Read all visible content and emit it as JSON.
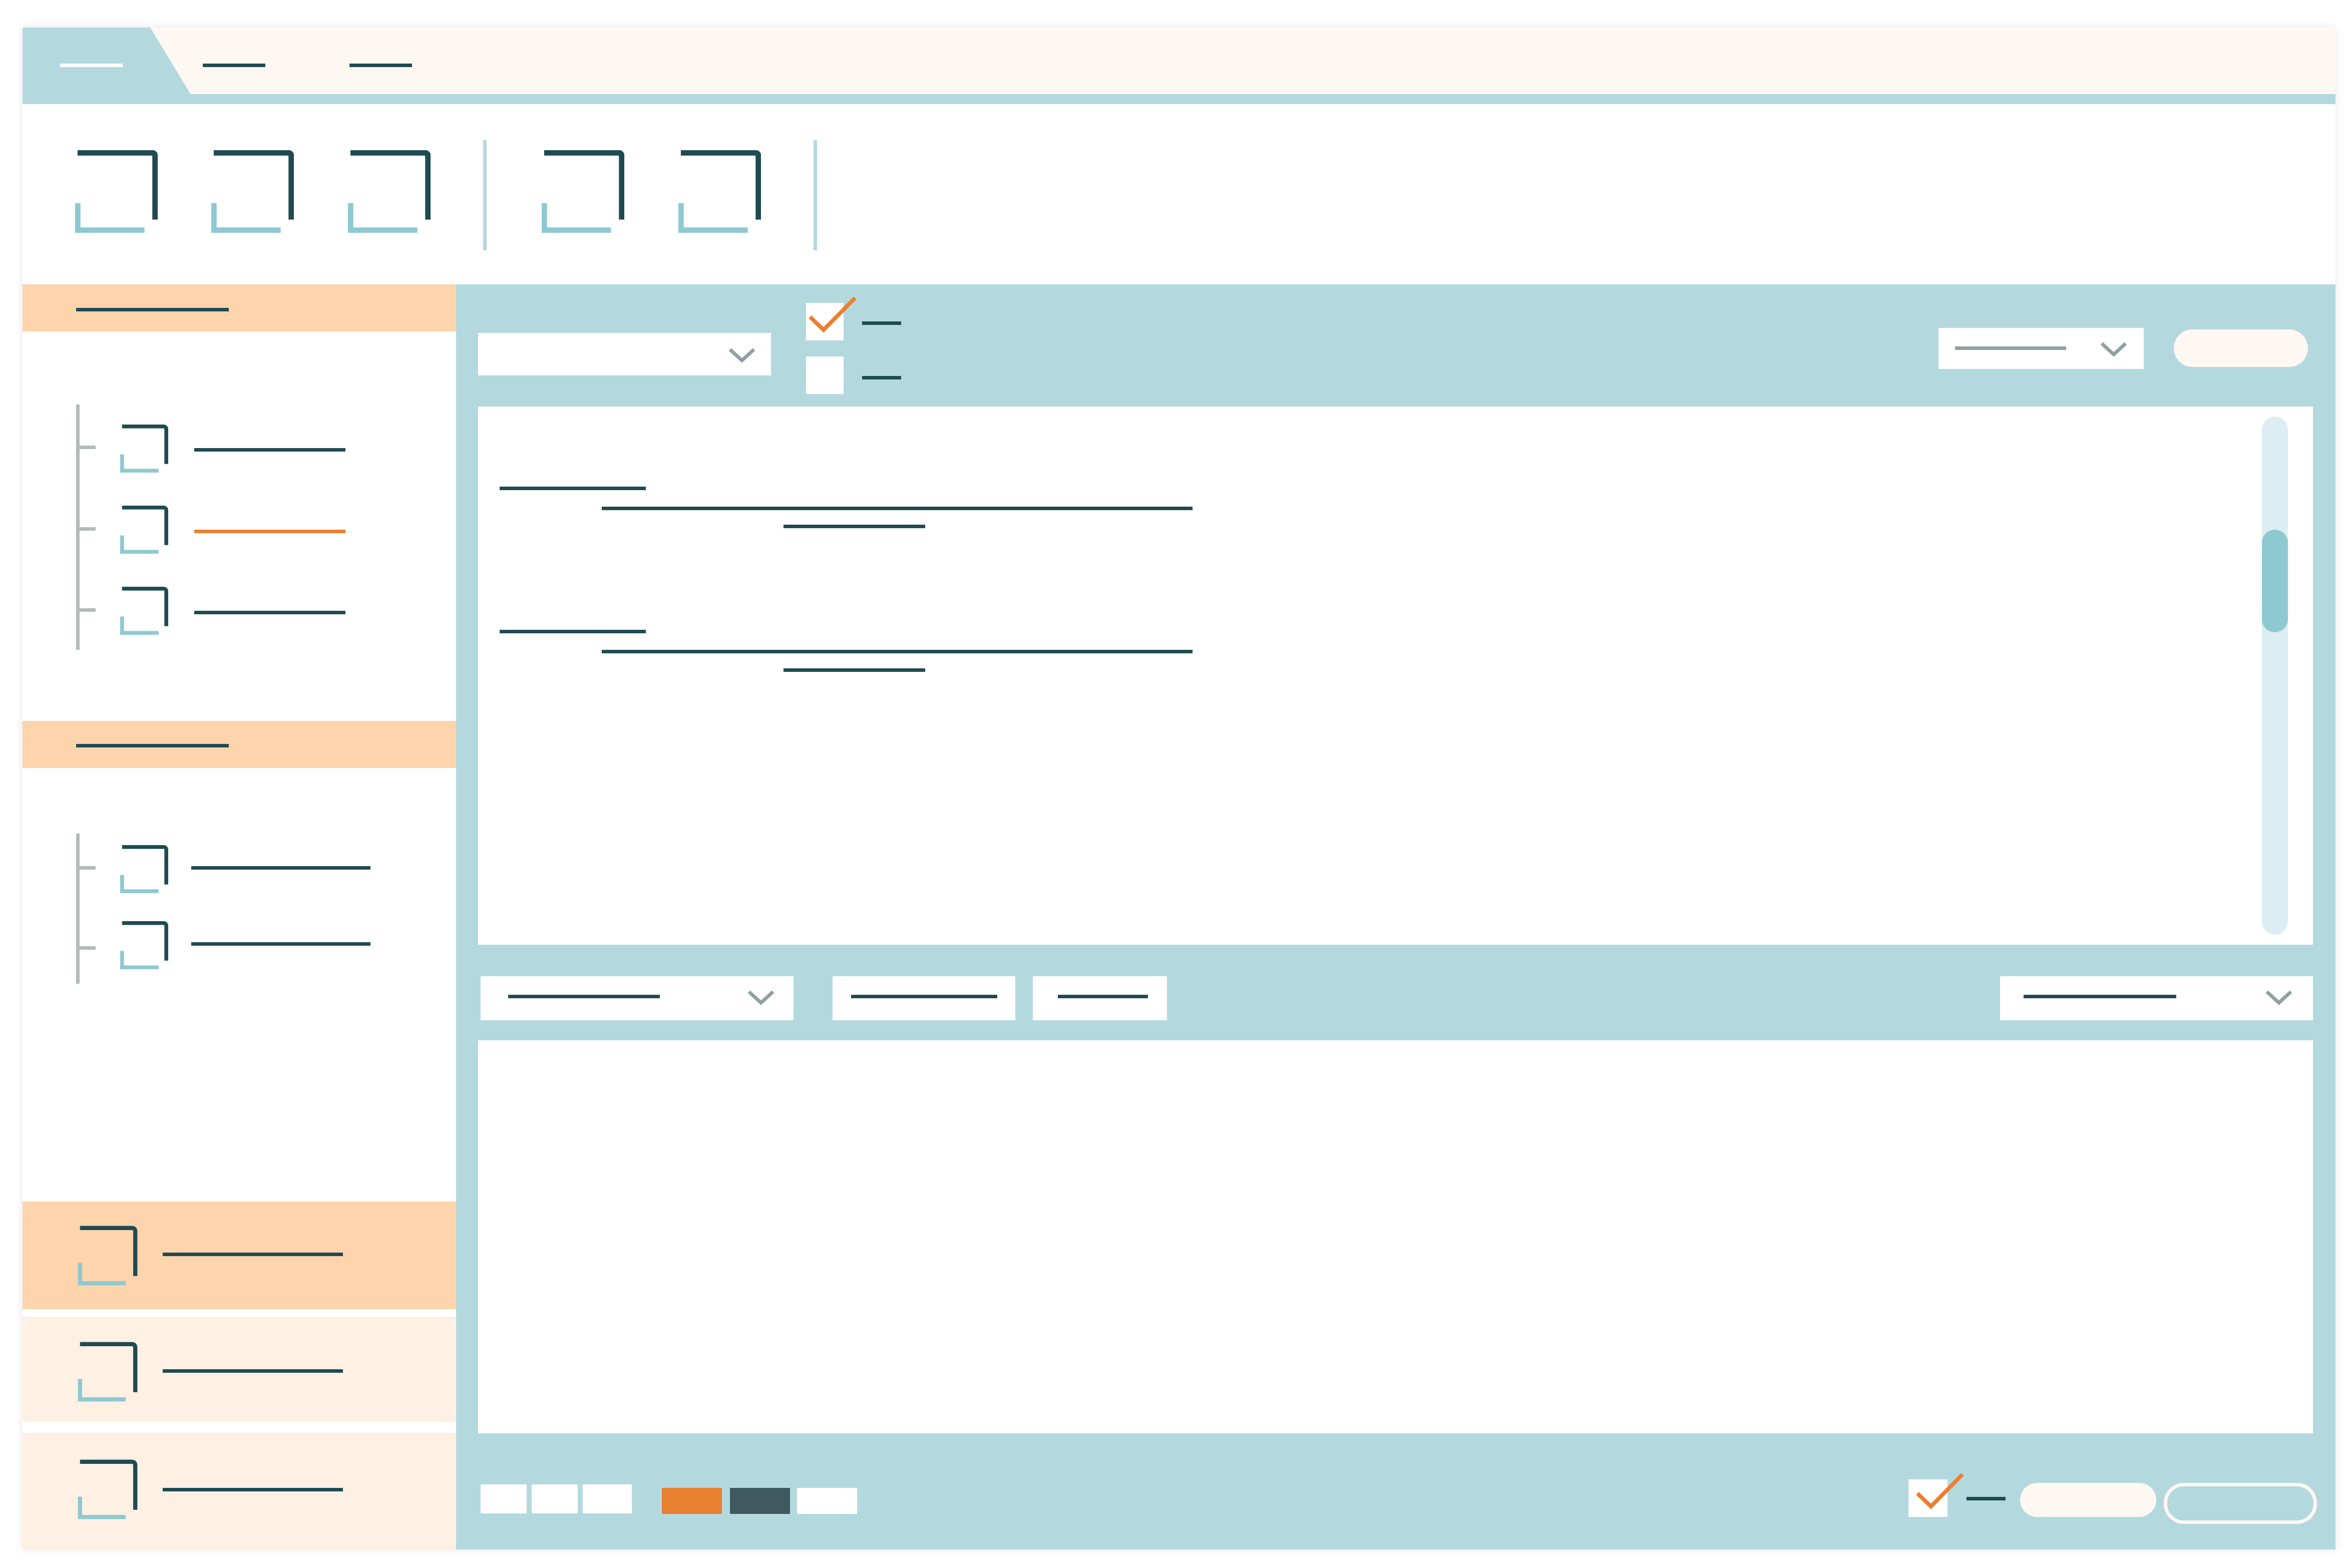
{
  "colors": {
    "teal_light": "#b3d9df",
    "teal_icon": "#8ec9d1",
    "dark": "#1f4a52",
    "peach": "#fdd4ab",
    "peach_light": "#fef0e3",
    "cream": "#fef8f2",
    "orange": "#e9802f",
    "slate": "#3f5a5e",
    "gray": "#8fa1a4"
  },
  "icons": {
    "toolbar": [
      "window-icon",
      "window-icon",
      "window-icon",
      "window-icon",
      "window-icon"
    ],
    "chevron": "chevron-down-icon",
    "check": "checkmark-icon"
  },
  "filters": {
    "checkbox_1_checked": true,
    "checkbox_2_checked": false
  },
  "footer": {
    "checkbox_checked": true,
    "swatches": [
      "#ffffff",
      "#ffffff",
      "#ffffff",
      "#e9802f",
      "#3f5a5e",
      "#ffffff"
    ]
  },
  "sidebar": {
    "selected_item_index": 1
  }
}
